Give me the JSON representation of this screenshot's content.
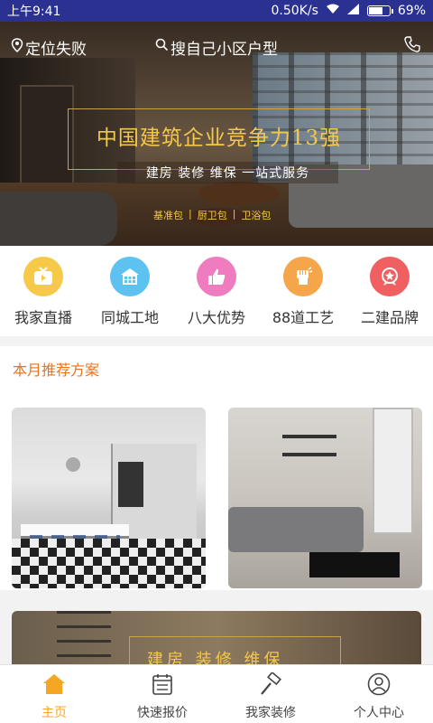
{
  "status_bar": {
    "time": "上午9:41",
    "network_speed": "0.50K/s",
    "battery": "69%",
    "battery_level": 0.69
  },
  "hero": {
    "location": "定位失败",
    "search_placeholder": "搜自己小区户型",
    "slogan_title": "中国建筑企业竞争力13强",
    "slogan_sub": "建房 装修 维保 一站式服务",
    "packages": [
      "基准包",
      "厨卫包",
      "卫浴包"
    ]
  },
  "quick_icons": [
    {
      "label": "我家直播",
      "icon": "tv-icon",
      "color": "#f7c948"
    },
    {
      "label": "同城工地",
      "icon": "building-icon",
      "color": "#5ec2f0"
    },
    {
      "label": "八大优势",
      "icon": "thumbs-up-icon",
      "color": "#f07cc0"
    },
    {
      "label": "88道工艺",
      "icon": "fist-icon",
      "color": "#f5a54a"
    },
    {
      "label": "二建品牌",
      "icon": "medal-icon",
      "color": "#f06060"
    }
  ],
  "recommend": {
    "title": "本月推荐方案"
  },
  "banner2": {
    "text": "建房 装修 维保"
  },
  "tabs": [
    {
      "label": "主页",
      "icon": "home-icon",
      "active": true
    },
    {
      "label": "快速报价",
      "icon": "calendar-icon",
      "active": false
    },
    {
      "label": "我家装修",
      "icon": "hammer-icon",
      "active": false
    },
    {
      "label": "个人中心",
      "icon": "user-icon",
      "active": false
    }
  ],
  "colors": {
    "status_bar": "#2a3190",
    "accent": "#f5a623",
    "section_title": "#e8731f",
    "slogan": "#f4c84a"
  }
}
